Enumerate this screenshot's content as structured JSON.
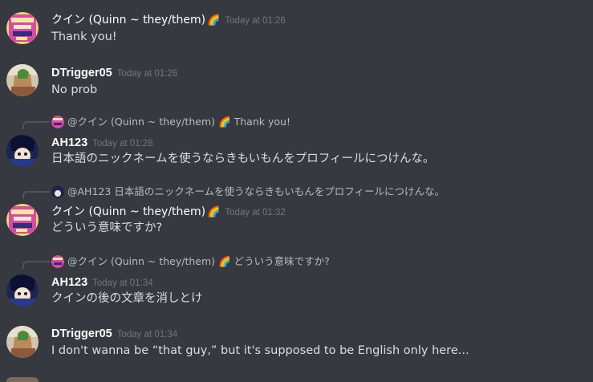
{
  "messages": [
    {
      "username": "クイン (Quinn ~ they/them)",
      "emoji": "🌈",
      "timestamp": "Today at 01:26",
      "text": "Thank you!"
    },
    {
      "username": "DTrigger05",
      "timestamp": "Today at 01:26",
      "text": "No prob"
    },
    {
      "reply": {
        "mention": "@クイン (Quinn ~ they/them)",
        "emoji": "🌈",
        "snippet": "Thank you!"
      },
      "username": "AH123",
      "timestamp": "Today at 01:28",
      "text": "日本語のニックネームを使うならきもいもんをプロフィールにつけんな。"
    },
    {
      "reply": {
        "mention": "@AH123",
        "snippet": "日本語のニックネームを使うならきもいもんをプロフィールにつけんな。"
      },
      "username": "クイン (Quinn ~ they/them)",
      "emoji": "🌈",
      "timestamp": "Today at 01:32",
      "text": "どういう意味ですか?"
    },
    {
      "reply": {
        "mention": "@クイン (Quinn ~ they/them)",
        "emoji": "🌈",
        "snippet": "どういう意味ですか?"
      },
      "username": "AH123",
      "timestamp": "Today at 01:34",
      "text": "クインの後の文章を消しとけ"
    },
    {
      "username": "DTrigger05",
      "timestamp": "Today at 01:34",
      "text": "I don't wanna be “that guy,” but it's supposed to be English only here..."
    }
  ]
}
